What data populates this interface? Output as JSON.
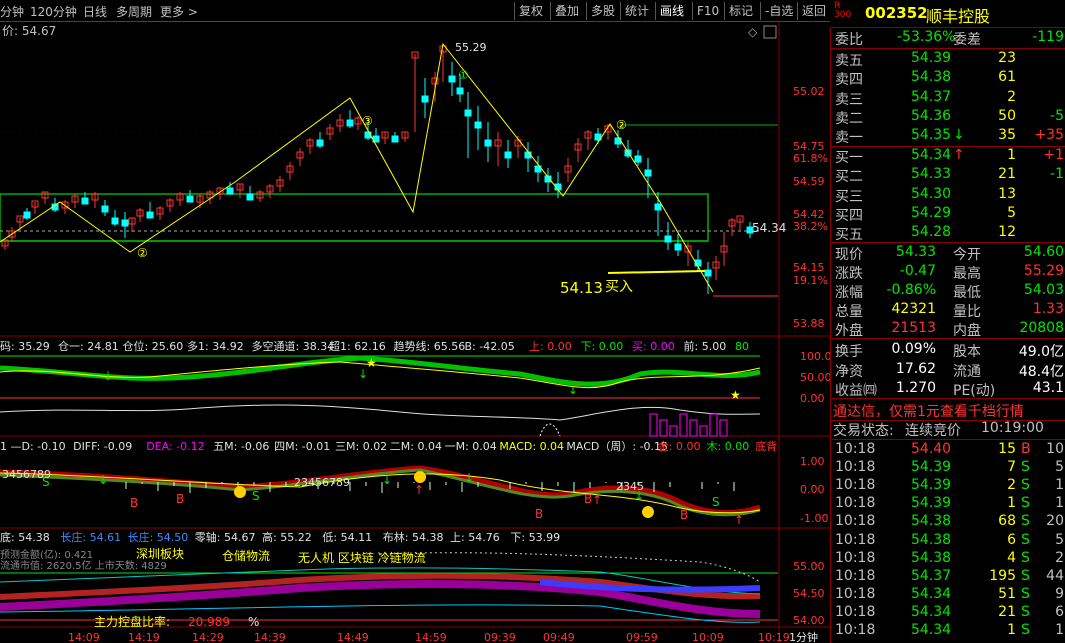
{
  "topbar": {
    "periods": [
      "分钟",
      "120分钟",
      "日线",
      "多周期",
      "更多 >"
    ],
    "buttons": [
      "复权",
      "叠加",
      "多股",
      "统计",
      "画线",
      "F10",
      "标记",
      "-自选",
      "返回"
    ],
    "selected": "画线"
  },
  "stock": {
    "badge_r": "R",
    "badge_num": "300",
    "code": "002352",
    "name": "顺丰控股"
  },
  "quote": {
    "webi_label": "委比",
    "webi": "-53.36%",
    "wecha_label": "委差",
    "wecha": "-119",
    "asks": [
      {
        "label": "卖五",
        "price": "54.39",
        "vol": "23",
        "chg": ""
      },
      {
        "label": "卖四",
        "price": "54.38",
        "vol": "61",
        "chg": ""
      },
      {
        "label": "卖三",
        "price": "54.37",
        "vol": "2",
        "chg": ""
      },
      {
        "label": "卖二",
        "price": "54.36",
        "vol": "50",
        "chg": "-5"
      },
      {
        "label": "卖一",
        "price": "54.35",
        "vol": "35",
        "chg": "+35",
        "arrow": "↓"
      }
    ],
    "bids": [
      {
        "label": "买一",
        "price": "54.34",
        "vol": "1",
        "chg": "+1",
        "arrow": "↑"
      },
      {
        "label": "买二",
        "price": "54.33",
        "vol": "21",
        "chg": "-1"
      },
      {
        "label": "买三",
        "price": "54.30",
        "vol": "13",
        "chg": ""
      },
      {
        "label": "买四",
        "price": "54.29",
        "vol": "5",
        "chg": ""
      },
      {
        "label": "买五",
        "price": "54.28",
        "vol": "12",
        "chg": ""
      }
    ],
    "stats": [
      {
        "l1": "现价",
        "v1": "54.33",
        "c1": "grn",
        "l2": "今开",
        "v2": "54.60",
        "c2": "grn"
      },
      {
        "l1": "涨跌",
        "v1": "-0.47",
        "c1": "grn",
        "l2": "最高",
        "v2": "55.29",
        "c2": "red"
      },
      {
        "l1": "涨幅",
        "v1": "-0.86%",
        "c1": "grn",
        "l2": "最低",
        "v2": "54.03",
        "c2": "grn"
      },
      {
        "l1": "总量",
        "v1": "42321",
        "c1": "yel",
        "l2": "量比",
        "v2": "1.33",
        "c2": "red"
      },
      {
        "l1": "外盘",
        "v1": "21513",
        "c1": "red",
        "l2": "内盘",
        "v2": "20808",
        "c2": "grn"
      }
    ],
    "stats2": [
      {
        "l1": "换手",
        "v1": "0.09%",
        "l2": "股本",
        "v2": "49.0亿"
      },
      {
        "l1": "净资",
        "v1": "17.62",
        "l2": "流通",
        "v2": "48.4亿"
      },
      {
        "l1": "收益㈣",
        "v1": "1.270",
        "l2": "PE(动)",
        "v2": "43.1"
      }
    ],
    "promo": "通达信，仅需1元查看千档行情",
    "status_label": "交易状态:",
    "status_value": "连续竞价",
    "status_time": "10:19:00"
  },
  "ticks": [
    {
      "t": "10:18",
      "p": "54.40",
      "v": "15",
      "s": "B",
      "n": "10"
    },
    {
      "t": "10:18",
      "p": "54.39",
      "v": "7",
      "s": "S",
      "n": "5"
    },
    {
      "t": "10:18",
      "p": "54.39",
      "v": "2",
      "s": "S",
      "n": "1"
    },
    {
      "t": "10:18",
      "p": "54.39",
      "v": "1",
      "s": "S",
      "n": "1"
    },
    {
      "t": "10:18",
      "p": "54.38",
      "v": "68",
      "s": "S",
      "n": "20"
    },
    {
      "t": "10:18",
      "p": "54.38",
      "v": "6",
      "s": "S",
      "n": "5"
    },
    {
      "t": "10:18",
      "p": "54.38",
      "v": "4",
      "s": "S",
      "n": "2"
    },
    {
      "t": "10:18",
      "p": "54.37",
      "v": "195",
      "s": "S",
      "n": "44"
    },
    {
      "t": "10:18",
      "p": "54.34",
      "v": "51",
      "s": "S",
      "n": "9"
    },
    {
      "t": "10:18",
      "p": "54.34",
      "v": "21",
      "s": "S",
      "n": "6"
    },
    {
      "t": "10:18",
      "p": "54.34",
      "v": "1",
      "s": "S",
      "n": "1"
    }
  ],
  "chart": {
    "price_label": "价: 54.67",
    "y_ticks": [
      "55.02",
      "54.75",
      "61.8%",
      "54.59",
      "54.42",
      "38.2%",
      "54.15",
      "19.1%",
      "53.88"
    ],
    "high_label": "55.29",
    "last_price_tag": "54.34",
    "buy_price": "54.13",
    "buy_text": "买入",
    "ind1_header": [
      {
        "t": "码: 35.29",
        "c": "wht"
      },
      {
        "t": "仓一: 24.81",
        "c": "wht"
      },
      {
        "t": "仓位: 25.60",
        "c": "wht"
      },
      {
        "t": "多1: 34.92",
        "c": "wht"
      },
      {
        "t": "多空通道: 38.34",
        "c": "wht"
      },
      {
        "t": "超1: 62.16",
        "c": "wht"
      },
      {
        "t": "趋势线: 65.56",
        "c": "wht"
      },
      {
        "t": "B: -42.05",
        "c": "wht"
      },
      {
        "t": "上: 0.00",
        "c": "red"
      },
      {
        "t": "下: 0.00",
        "c": "grn"
      },
      {
        "t": "买: 0.00",
        "c": "mag"
      },
      {
        "t": "前: 5.00",
        "c": "wht"
      },
      {
        "t": "80",
        "c": "grn"
      }
    ],
    "ind1_ticks": [
      "100.0",
      "50.00",
      "0.00"
    ],
    "ind2_header": [
      {
        "t": "1 —D: -0.10",
        "c": "wht"
      },
      {
        "t": "DIFF: -0.09",
        "c": "wht"
      },
      {
        "t": "DEA: -0.12",
        "c": "mag"
      },
      {
        "t": "五M: -0.06",
        "c": "wht"
      },
      {
        "t": "四M: -0.01",
        "c": "wht"
      },
      {
        "t": "三M: 0.02",
        "c": "wht"
      },
      {
        "t": "二M: 0.04",
        "c": "wht"
      },
      {
        "t": "一M: 0.04",
        "c": "wht"
      },
      {
        "t": "MACD: 0.04",
        "c": "yel"
      },
      {
        "t": "MACD（周）: -0.15",
        "c": "wht"
      },
      {
        "t": "金: 0.00",
        "c": "red"
      },
      {
        "t": "木: 0.00",
        "c": "grn"
      },
      {
        "t": "底背",
        "c": "red"
      }
    ],
    "ind2_ticks": [
      "1.00",
      "0.00",
      "-1.00"
    ],
    "ind3_header": [
      {
        "t": "底: 54.38",
        "c": "wht"
      },
      {
        "t": "长庄: 54.61",
        "c": "blu"
      },
      {
        "t": "长庄: 54.50",
        "c": "blu"
      },
      {
        "t": "零轴: 54.67",
        "c": "wht"
      },
      {
        "t": "高: 55.22",
        "c": "wht"
      },
      {
        "t": "低: 54.11",
        "c": "wht"
      },
      {
        "t": "布林: 54.38",
        "c": "wht"
      },
      {
        "t": "上: 54.76",
        "c": "wht"
      },
      {
        "t": "下: 53.99",
        "c": "wht"
      }
    ],
    "ind3_ticks": [
      "55.00",
      "54.50",
      "54.00"
    ],
    "ind3_texts": [
      "深圳板块",
      "仓储物流",
      "无人机 区块链 冷链物流"
    ],
    "ind3_info1": "预测金额(亿): 0.421",
    "ind3_info2": "流通市值: 2620.5亿 上市天数: 4829",
    "ind3_bottom": "主力控盘比率:",
    "ind3_bottom_val": "20.989",
    "ind3_bottom_unit": "%",
    "time_labels": [
      "14:09",
      "14:19",
      "14:29",
      "14:39",
      "14:49",
      "14:59",
      "09:39",
      "09:49",
      "09:59",
      "10:09",
      "10:19"
    ],
    "period_label": "1分钟",
    "diamond": "◇",
    "markers": {
      "c1": "①",
      "c2": "②",
      "c3": "③"
    }
  }
}
